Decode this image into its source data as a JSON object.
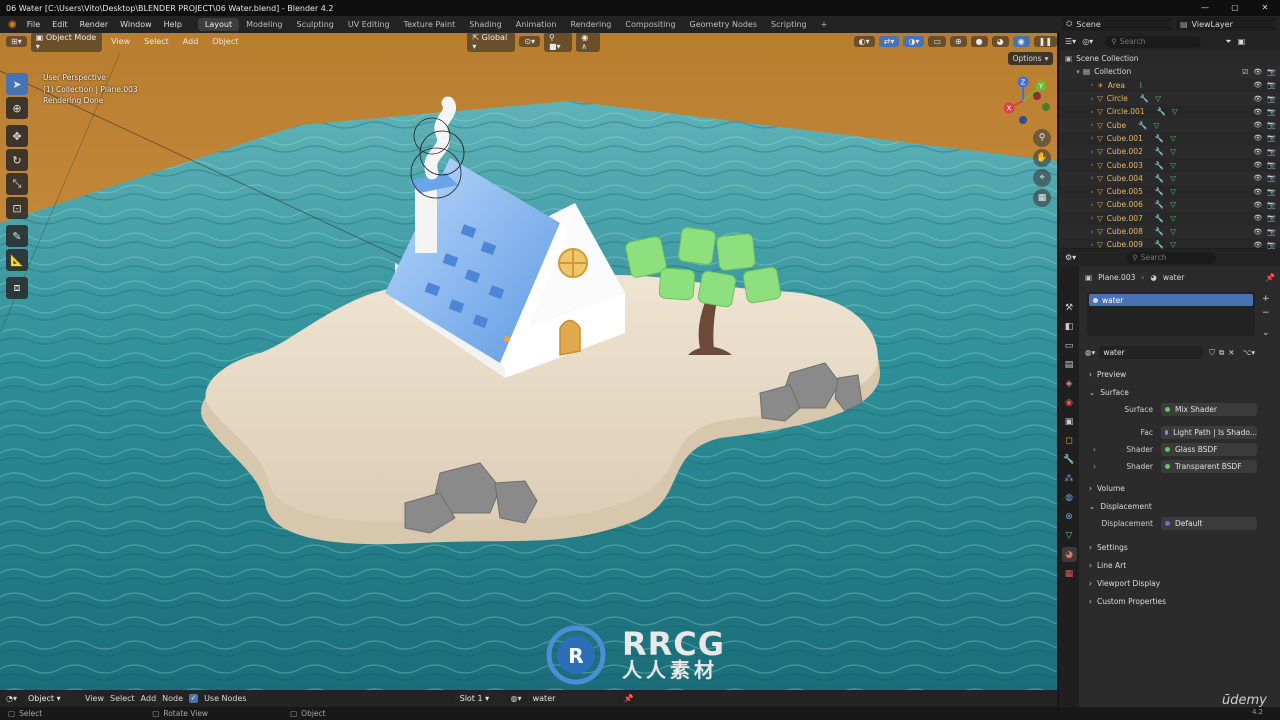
{
  "window": {
    "title": "06 Water [C:\\Users\\Vito\\Desktop\\BLENDER PROJECT\\06 Water.blend] - Blender 4.2",
    "controls": [
      "—",
      "▢",
      "✕"
    ]
  },
  "menu": {
    "items": [
      "File",
      "Edit",
      "Render",
      "Window",
      "Help"
    ],
    "workspaces": [
      "Layout",
      "Modeling",
      "Sculpting",
      "UV Editing",
      "Texture Paint",
      "Shading",
      "Animation",
      "Rendering",
      "Compositing",
      "Geometry Nodes",
      "Scripting",
      "+"
    ],
    "active_workspace": "Layout",
    "scene": "Scene",
    "view_layer": "ViewLayer"
  },
  "viewport": {
    "mode": "Object Mode",
    "menus": [
      "View",
      "Select",
      "Add",
      "Object"
    ],
    "orientation": "Global",
    "info_lines": [
      "User Perspective",
      "(1) Collection | Plane.003",
      "Rendering Done"
    ],
    "options_label": "Options",
    "gizmo_axes": [
      "Z",
      "Y",
      "X"
    ]
  },
  "footer": {
    "editor_mode": "Object",
    "menus": [
      "View",
      "Select",
      "Add",
      "Node"
    ],
    "use_nodes_label": "Use Nodes",
    "slot": "Slot 1",
    "material": "water"
  },
  "statusbar": {
    "items": [
      "Select",
      "Rotate View",
      "Object"
    ],
    "version": "4.2"
  },
  "outliner": {
    "search_placeholder": "Search",
    "root": "Scene Collection",
    "collection": "Collection",
    "items": [
      "Area",
      "Circle",
      "Circle.001",
      "Cube",
      "Cube.001",
      "Cube.002",
      "Cube.003",
      "Cube.004",
      "Cube.005",
      "Cube.006",
      "Cube.007",
      "Cube.008",
      "Cube.009"
    ]
  },
  "properties": {
    "search_placeholder": "Search",
    "object": "Plane.003",
    "material": "water",
    "slot_item": "water",
    "material_field": "water",
    "panels_top": [
      "Preview",
      "Surface"
    ],
    "surface_rows": [
      {
        "label": "Surface",
        "value": "Mix Shader"
      },
      {
        "label": "Fac",
        "value": "Light Path | Is Shado..."
      },
      {
        "label": "Shader",
        "value": "Glass BSDF"
      },
      {
        "label": "Shader",
        "value": "Transparent BSDF"
      }
    ],
    "volume_panel": "Volume",
    "displacement_panel": "Displacement",
    "displacement_row": {
      "label": "Displacement",
      "value": "Default"
    },
    "bottom_panels": [
      "Settings",
      "Line Art",
      "Viewport Display",
      "Custom Properties"
    ]
  },
  "watermark": {
    "title": "RRCG",
    "subtitle": "人人素材",
    "brand": "ūdemy"
  }
}
